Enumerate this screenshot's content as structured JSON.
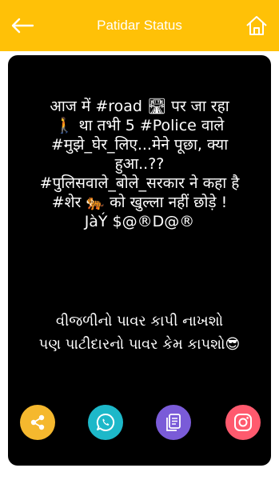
{
  "header": {
    "title": "Patidar Status",
    "back_icon": "arrow-left-icon",
    "home_icon": "home-icon"
  },
  "status": {
    "hindi_text": "आज में #road 🛣 पर जा रहा\n🚶 था तभी 5 #Police वाले\n#मुझे_घेर_लिए...मेने पूछा, क्या\nहुआ..??\n#पुलिसवाले_बोले_सरकार ने कहा है\n#शेर 🐅 को खुल्ला नहीं छोड़े !\nJàÝ $@®D@®",
    "gujarati_text": "વીજળીનો પાવર કાપી નાખશો\nપણ પાટીદારનો પાવર કેમ કાપશો😎"
  },
  "actions": [
    {
      "name": "share",
      "icon": "share-icon",
      "color": "#f5b82e"
    },
    {
      "name": "whatsapp",
      "icon": "whatsapp-icon",
      "color": "#1db8c9"
    },
    {
      "name": "copy",
      "icon": "copy-icon",
      "color": "#7a5bd8"
    },
    {
      "name": "instagram",
      "icon": "instagram-icon",
      "color": "#ff5a6e"
    }
  ],
  "colors": {
    "header_bg": "#ffc107",
    "card_bg": "#000000"
  }
}
